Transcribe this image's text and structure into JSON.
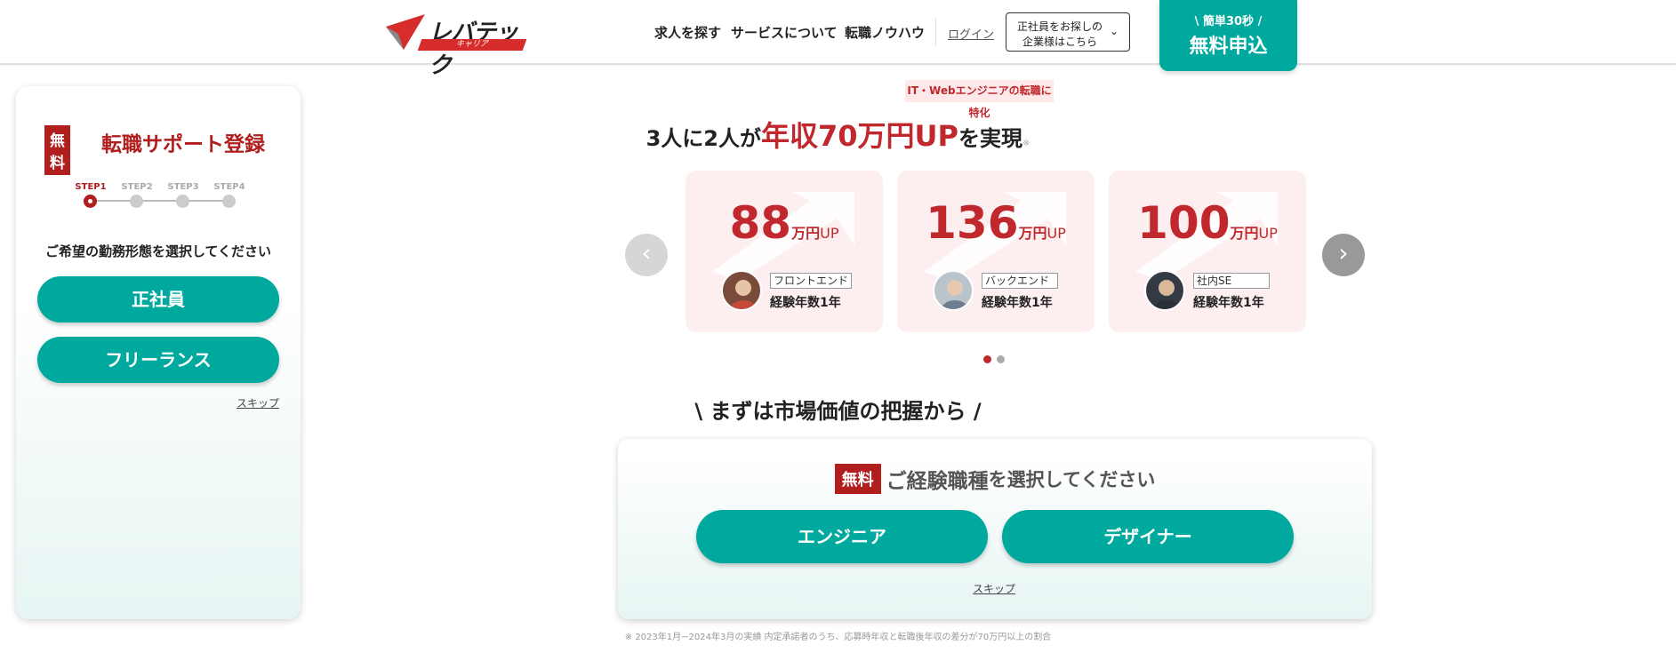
{
  "header": {
    "logo_main": "レバテック",
    "logo_sub": "キャリア",
    "nav": [
      "求人を探す",
      "サービスについて",
      "転職ノウハウ"
    ],
    "login": "ログイン",
    "corp_btn_line1": "正社員をお探しの",
    "corp_btn_line2": "企業様はこちら",
    "apply_line1": "\\ 簡単30秒 /",
    "apply_line2": "無料申込"
  },
  "sidebar": {
    "badge": "無料",
    "title": "転職サポート登録",
    "steps": [
      "STEP1",
      "STEP2",
      "STEP3",
      "STEP4"
    ],
    "question": "ご希望の勤務形態を選択してください",
    "options": [
      "正社員",
      "フリーランス"
    ],
    "skip": "スキップ"
  },
  "main": {
    "tag": "IT・Webエンジニアの転職に特化",
    "headline_a1": "3人に2人が",
    "headline_b": "年収70万円UP",
    "headline_a2": "を実現",
    "headline_note": "※",
    "cards": [
      {
        "amount": "88",
        "unit": "万円",
        "up": "UP",
        "role": "フロントエンド",
        "exp": "経験年数1年"
      },
      {
        "amount": "136",
        "unit": "万円",
        "up": "UP",
        "role": "バックエンド",
        "exp": "経験年数1年"
      },
      {
        "amount": "100",
        "unit": "万円",
        "up": "UP",
        "role": "社内SE",
        "exp": "経験年数1年"
      }
    ],
    "section_title": "\\ まずは市場価値の把握から /",
    "box_badge": "無料",
    "box_title1": "ご経験職種",
    "box_title2": "を選択してください",
    "box_options": [
      "エンジニア",
      "デザイナー"
    ],
    "box_skip": "スキップ",
    "footnote": "※ 2023年1月~2024年3月の実績 内定承諾者のうち、応募時年収と転職後年収の差分が70万円以上の割合"
  },
  "colors": {
    "accent": "#00a99d",
    "brand_red": "#c0282d"
  }
}
